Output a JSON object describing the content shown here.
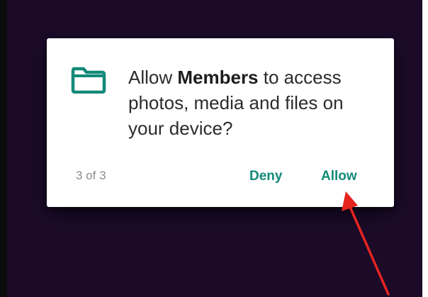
{
  "dialog": {
    "message_prefix": "Allow ",
    "app_name": "Members",
    "message_suffix": " to access photos, media and files on your device?",
    "counter": "3 of 3",
    "deny_label": "Deny",
    "allow_label": "Allow",
    "icon": "folder-icon"
  },
  "colors": {
    "accent": "#128a78",
    "screen_background": "#1b0b29",
    "annotation_arrow": "#e5241f"
  },
  "annotation": {
    "icon": "red-arrow-pointing-to-allow-button"
  }
}
